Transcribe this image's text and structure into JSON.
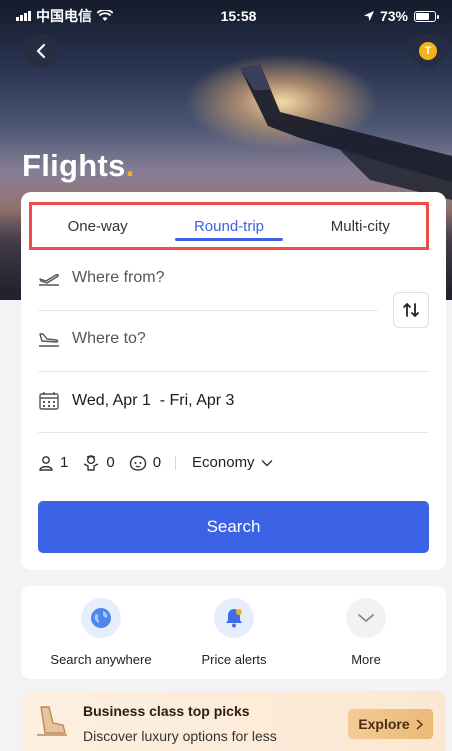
{
  "status_bar": {
    "carrier": "中国电信",
    "time": "15:58",
    "battery": "73%"
  },
  "hero": {
    "title": "Flights",
    "coin_letter": "T"
  },
  "trip_tabs": [
    {
      "label": "One-way"
    },
    {
      "label": "Round-trip",
      "active": true
    },
    {
      "label": "Multi-city"
    }
  ],
  "fields": {
    "from_placeholder": "Where from?",
    "to_placeholder": "Where to?",
    "dates": "Wed, Apr 1  - Fri, Apr 3"
  },
  "passengers": {
    "adults": "1",
    "children": "0",
    "infants": "0",
    "cabin_class": "Economy"
  },
  "search_button": "Search",
  "quick_links": [
    {
      "label": "Search anywhere",
      "icon": "globe-icon"
    },
    {
      "label": "Price alerts",
      "icon": "bell-icon"
    },
    {
      "label": "More",
      "icon": "chevron-down-icon"
    }
  ],
  "promo": {
    "title": "Business class top picks",
    "subtitle": "Discover luxury options for less",
    "button": "Explore"
  },
  "colors": {
    "accent": "#3c63e6",
    "highlight_border": "#ef4b4b",
    "gold": "#f5b21f"
  }
}
